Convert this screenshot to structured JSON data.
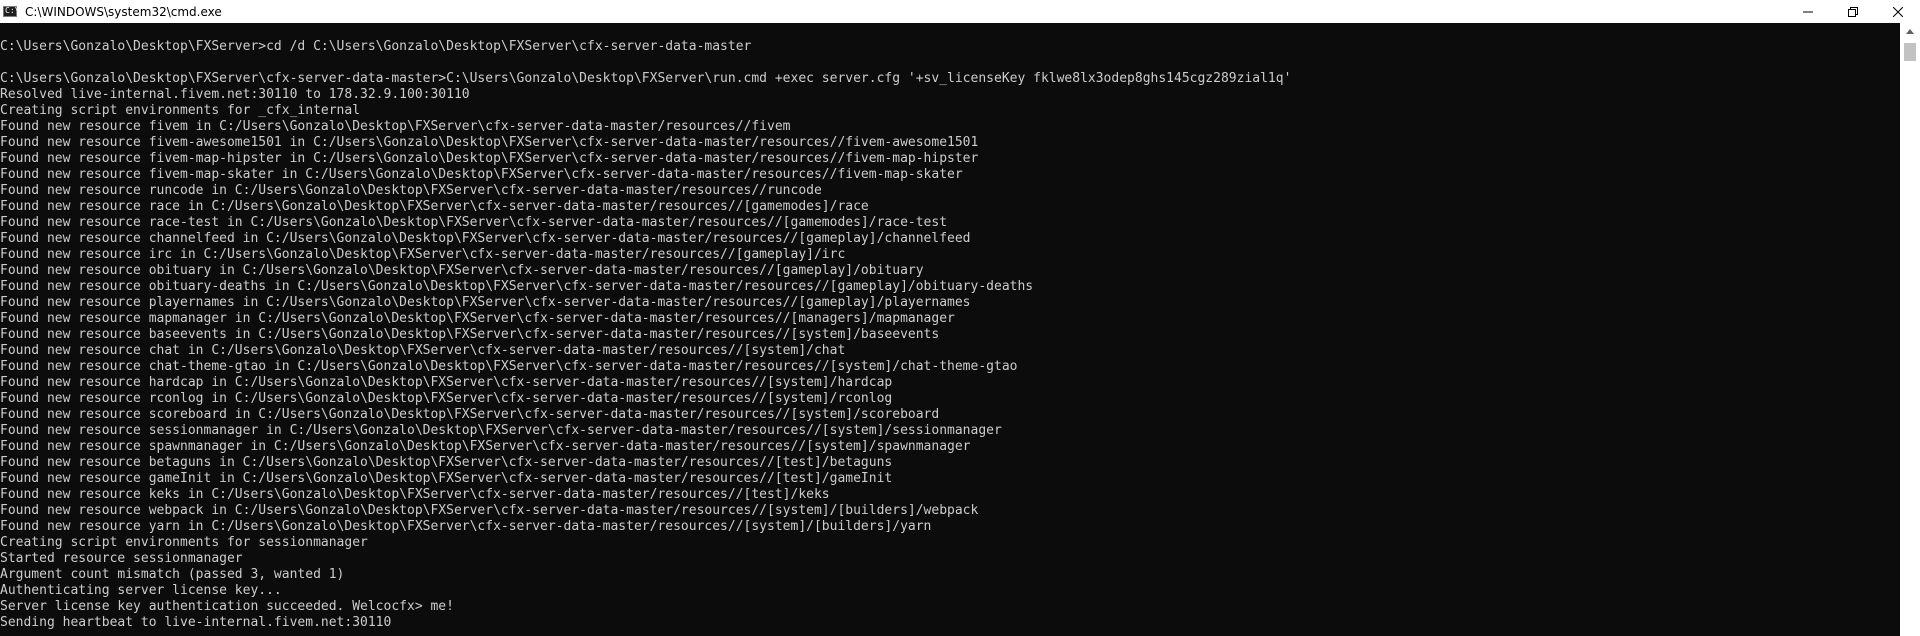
{
  "window": {
    "title": "C:\\WINDOWS\\system32\\cmd.exe",
    "icon": "cmd-icon",
    "icon_glyph": "C:\\",
    "controls": [
      "minimize-icon",
      "restore-icon",
      "close-icon"
    ]
  },
  "console": {
    "background": "#0c0c0c",
    "foreground": "#cccccc",
    "lines": [
      "",
      "C:\\Users\\Gonzalo\\Desktop\\FXServer>cd /d C:\\Users\\Gonzalo\\Desktop\\FXServer\\cfx-server-data-master",
      "",
      "C:\\Users\\Gonzalo\\Desktop\\FXServer\\cfx-server-data-master>C:\\Users\\Gonzalo\\Desktop\\FXServer\\run.cmd +exec server.cfg '+sv_licenseKey fklwe8lx3odep8ghs145cgz289zial1q'",
      "Resolved live-internal.fivem.net:30110 to 178.32.9.100:30110",
      "Creating script environments for _cfx_internal",
      "Found new resource fivem in C:/Users\\Gonzalo\\Desktop\\FXServer\\cfx-server-data-master/resources//fivem",
      "Found new resource fivem-awesome1501 in C:/Users\\Gonzalo\\Desktop\\FXServer\\cfx-server-data-master/resources//fivem-awesome1501",
      "Found new resource fivem-map-hipster in C:/Users\\Gonzalo\\Desktop\\FXServer\\cfx-server-data-master/resources//fivem-map-hipster",
      "Found new resource fivem-map-skater in C:/Users\\Gonzalo\\Desktop\\FXServer\\cfx-server-data-master/resources//fivem-map-skater",
      "Found new resource runcode in C:/Users\\Gonzalo\\Desktop\\FXServer\\cfx-server-data-master/resources//runcode",
      "Found new resource race in C:/Users\\Gonzalo\\Desktop\\FXServer\\cfx-server-data-master/resources//[gamemodes]/race",
      "Found new resource race-test in C:/Users\\Gonzalo\\Desktop\\FXServer\\cfx-server-data-master/resources//[gamemodes]/race-test",
      "Found new resource channelfeed in C:/Users\\Gonzalo\\Desktop\\FXServer\\cfx-server-data-master/resources//[gameplay]/channelfeed",
      "Found new resource irc in C:/Users\\Gonzalo\\Desktop\\FXServer\\cfx-server-data-master/resources//[gameplay]/irc",
      "Found new resource obituary in C:/Users\\Gonzalo\\Desktop\\FXServer\\cfx-server-data-master/resources//[gameplay]/obituary",
      "Found new resource obituary-deaths in C:/Users\\Gonzalo\\Desktop\\FXServer\\cfx-server-data-master/resources//[gameplay]/obituary-deaths",
      "Found new resource playernames in C:/Users\\Gonzalo\\Desktop\\FXServer\\cfx-server-data-master/resources//[gameplay]/playernames",
      "Found new resource mapmanager in C:/Users\\Gonzalo\\Desktop\\FXServer\\cfx-server-data-master/resources//[managers]/mapmanager",
      "Found new resource baseevents in C:/Users\\Gonzalo\\Desktop\\FXServer\\cfx-server-data-master/resources//[system]/baseevents",
      "Found new resource chat in C:/Users\\Gonzalo\\Desktop\\FXServer\\cfx-server-data-master/resources//[system]/chat",
      "Found new resource chat-theme-gtao in C:/Users\\Gonzalo\\Desktop\\FXServer\\cfx-server-data-master/resources//[system]/chat-theme-gtao",
      "Found new resource hardcap in C:/Users\\Gonzalo\\Desktop\\FXServer\\cfx-server-data-master/resources//[system]/hardcap",
      "Found new resource rconlog in C:/Users\\Gonzalo\\Desktop\\FXServer\\cfx-server-data-master/resources//[system]/rconlog",
      "Found new resource scoreboard in C:/Users\\Gonzalo\\Desktop\\FXServer\\cfx-server-data-master/resources//[system]/scoreboard",
      "Found new resource sessionmanager in C:/Users\\Gonzalo\\Desktop\\FXServer\\cfx-server-data-master/resources//[system]/sessionmanager",
      "Found new resource spawnmanager in C:/Users\\Gonzalo\\Desktop\\FXServer\\cfx-server-data-master/resources//[system]/spawnmanager",
      "Found new resource betaguns in C:/Users\\Gonzalo\\Desktop\\FXServer\\cfx-server-data-master/resources//[test]/betaguns",
      "Found new resource gameInit in C:/Users\\Gonzalo\\Desktop\\FXServer\\cfx-server-data-master/resources//[test]/gameInit",
      "Found new resource keks in C:/Users\\Gonzalo\\Desktop\\FXServer\\cfx-server-data-master/resources//[test]/keks",
      "Found new resource webpack in C:/Users\\Gonzalo\\Desktop\\FXServer\\cfx-server-data-master/resources//[system]/[builders]/webpack",
      "Found new resource yarn in C:/Users\\Gonzalo\\Desktop\\FXServer\\cfx-server-data-master/resources//[system]/[builders]/yarn",
      "Creating script environments for sessionmanager",
      "Started resource sessionmanager",
      "Argument count mismatch (passed 3, wanted 1)",
      "Authenticating server license key...",
      "Server license key authentication succeeded. Welcocfx> me!",
      "Sending heartbeat to live-internal.fivem.net:30110"
    ]
  },
  "scrollbar": {
    "up_icon": "scroll-up-arrow-icon",
    "position": 0.0
  }
}
